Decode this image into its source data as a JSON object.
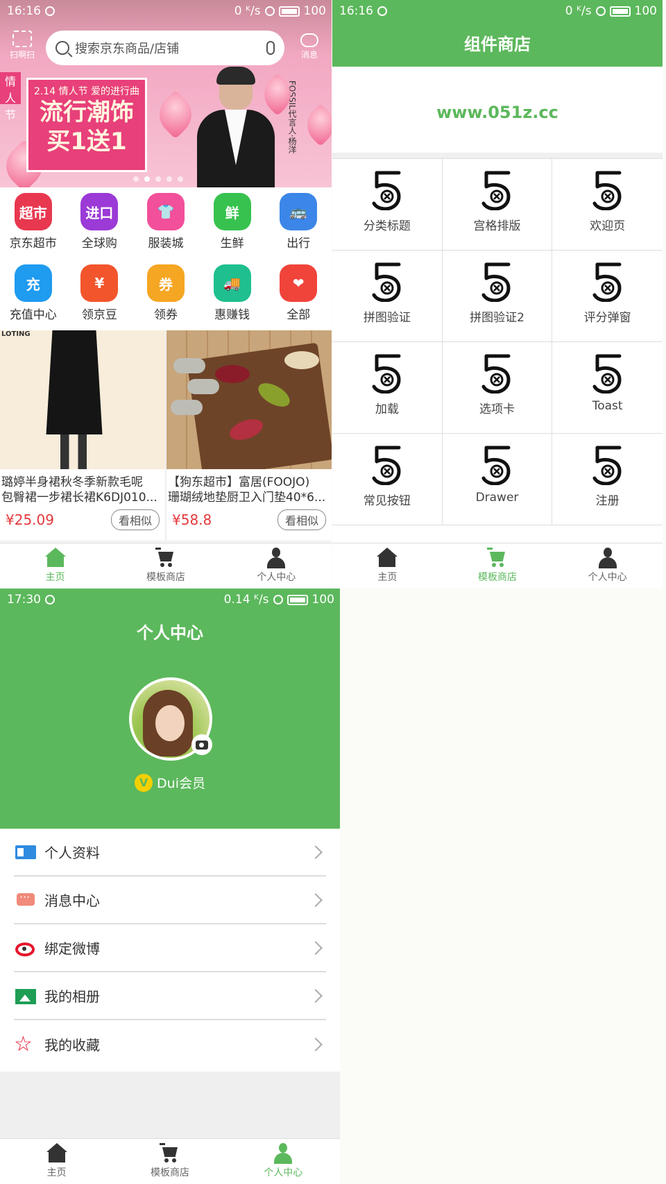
{
  "home": {
    "status": {
      "time": "16:16",
      "net": "0 ᴷ/s",
      "battery": "100"
    },
    "scan_label": "扫啊扫",
    "search_placeholder": "搜索京东商品/店铺",
    "message_label": "消息",
    "banner": {
      "side": "情人节",
      "subtitle": "2.14 情人节 爱的进行曲",
      "line1": "流行潮饰",
      "line2": "买1送1",
      "vertical_text": "FOSSIL代言人·杨洋"
    },
    "categories": [
      {
        "label": "京东超市",
        "badge": "超市",
        "color": "#e8384f"
      },
      {
        "label": "全球购",
        "badge": "进口",
        "color": "#9b3ad6"
      },
      {
        "label": "服装城",
        "badge": "👕",
        "color": "#f2509a"
      },
      {
        "label": "生鲜",
        "badge": "鲜",
        "color": "#37c24f"
      },
      {
        "label": "出行",
        "badge": "🚌",
        "color": "#3b86e8"
      },
      {
        "label": "充值中心",
        "badge": "充",
        "color": "#1f9bf0"
      },
      {
        "label": "领京豆",
        "badge": "¥",
        "color": "#f2552c"
      },
      {
        "label": "领券",
        "badge": "券",
        "color": "#f5a623"
      },
      {
        "label": "惠赚钱",
        "badge": "🚚",
        "color": "#1fbf8f"
      },
      {
        "label": "全部",
        "badge": "❤",
        "color": "#f0443b"
      }
    ],
    "products": [
      {
        "tag": "LOTING",
        "line1": "璐婷半身裙秋冬季新款毛呢",
        "line2": "包臀裙一步裙长裙K6DJ010...",
        "price": "¥25.09",
        "similar": "看相似"
      },
      {
        "line1": "【狗东超市】富居(FOOJO)",
        "line2": "珊瑚绒地垫厨卫入门垫40*6...",
        "price": "¥58.8",
        "similar": "看相似"
      }
    ]
  },
  "store": {
    "status": {
      "time": "16:16",
      "net": "0 ᴷ/s",
      "battery": "100"
    },
    "title": "组件商店",
    "url": "www.051z.cc",
    "items": [
      "分类标题",
      "宫格排版",
      "欢迎页",
      "拼图验证",
      "拼图验证2",
      "评分弹窗",
      "加载",
      "选项卡",
      "Toast",
      "常见按钮",
      "Drawer",
      "注册"
    ]
  },
  "profile": {
    "status": {
      "time": "17:30",
      "net": "0.14 ᴷ/s",
      "battery": "100"
    },
    "title": "个人中心",
    "member_badge": "V",
    "member_label": "Dui会员",
    "menu": [
      {
        "label": "个人资料",
        "icon": "id-card-icon"
      },
      {
        "label": "消息中心",
        "icon": "chat-icon"
      },
      {
        "label": "绑定微博",
        "icon": "weibo-icon"
      },
      {
        "label": "我的相册",
        "icon": "photo-icon"
      },
      {
        "label": "我的收藏",
        "icon": "star-icon"
      }
    ]
  },
  "tabs": [
    "主页",
    "模板商店",
    "个人中心"
  ],
  "colors": {
    "accent": "#5cb85c",
    "price": "#e4393c"
  }
}
